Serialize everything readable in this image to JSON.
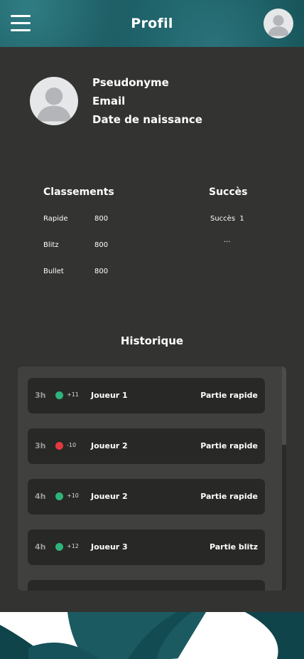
{
  "header": {
    "title": "Profil"
  },
  "profile": {
    "pseudonyme_label": "Pseudonyme",
    "email_label": "Email",
    "birthdate_label": "Date de naissance"
  },
  "rankings": {
    "title": "Classements",
    "items": [
      {
        "label": "Rapide",
        "value": "800"
      },
      {
        "label": "Blitz",
        "value": "800"
      },
      {
        "label": "Bullet",
        "value": "800"
      }
    ]
  },
  "achievements": {
    "title": "Succès",
    "items": [
      "Succès  1",
      "..."
    ]
  },
  "history": {
    "title": "Historique",
    "rows": [
      {
        "time": "3h",
        "result": "win",
        "delta": "+11",
        "player": "Joueur 1",
        "mode": "Partie rapide"
      },
      {
        "time": "3h",
        "result": "loss",
        "delta": "-10",
        "player": "Joueur 2",
        "mode": "Partie rapide"
      },
      {
        "time": "4h",
        "result": "win",
        "delta": "+10",
        "player": "Joueur 2",
        "mode": "Partie rapide"
      },
      {
        "time": "4h",
        "result": "win",
        "delta": "+12",
        "player": "Joueur 3",
        "mode": "Partie blitz"
      }
    ]
  },
  "colors": {
    "header_teal": "#1d646b",
    "panel_bg": "#333331",
    "win_dot": "#2eb37a",
    "loss_dot": "#e23a3f"
  }
}
